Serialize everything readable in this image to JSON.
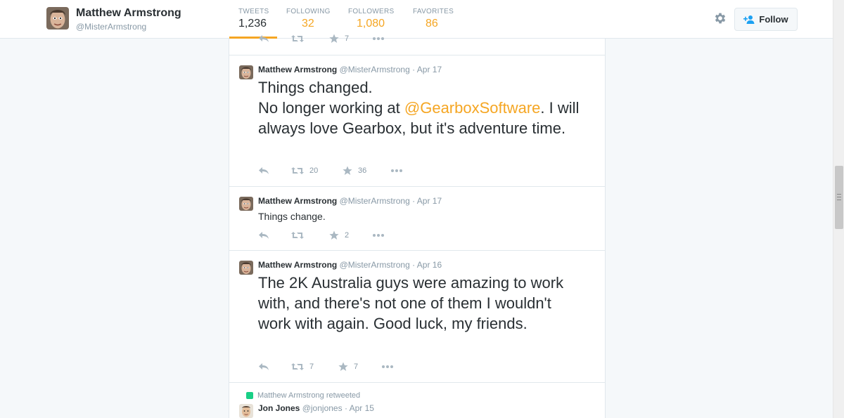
{
  "profile": {
    "name": "Matthew Armstrong",
    "handle": "@MisterArmstrong"
  },
  "stats": [
    {
      "label": "TWEETS",
      "value": "1,236"
    },
    {
      "label": "FOLLOWING",
      "value": "32"
    },
    {
      "label": "FOLLOWERS",
      "value": "1,080"
    },
    {
      "label": "FAVORITES",
      "value": "86"
    }
  ],
  "header": {
    "follow_label": "Follow",
    "settings_icon": "gear-icon"
  },
  "partial_tweet": {
    "retweets": "",
    "favorites": "7"
  },
  "tweets": [
    {
      "name": "Matthew Armstrong",
      "handle": "@MisterArmstrong",
      "date": "· Apr 17",
      "text_line1": "Things changed.",
      "text_line2_pre": "No longer working at ",
      "mention": "@GearboxSoftware",
      "text_line2_post": ".  I will always love Gearbox, but it's adventure time.",
      "retweets": "20",
      "favorites": "36"
    },
    {
      "name": "Matthew Armstrong",
      "handle": "@MisterArmstrong",
      "date": "· Apr 17",
      "text": "Things change.",
      "retweets": "",
      "favorites": "2"
    },
    {
      "name": "Matthew Armstrong",
      "handle": "@MisterArmstrong",
      "date": "· Apr 16",
      "text": "The 2K Australia guys were amazing to work with, and there's not one of them I wouldn't work with again. Good luck, my friends.",
      "retweets": "7",
      "favorites": "7"
    }
  ],
  "retweet": {
    "context": "Matthew Armstrong retweeted",
    "name": "Jon Jones",
    "handle": "@jonjones",
    "date": "· Apr 15"
  },
  "colors": {
    "accent": "#f5a623",
    "muted": "#8899a6",
    "retweet_green": "#19cf86"
  }
}
